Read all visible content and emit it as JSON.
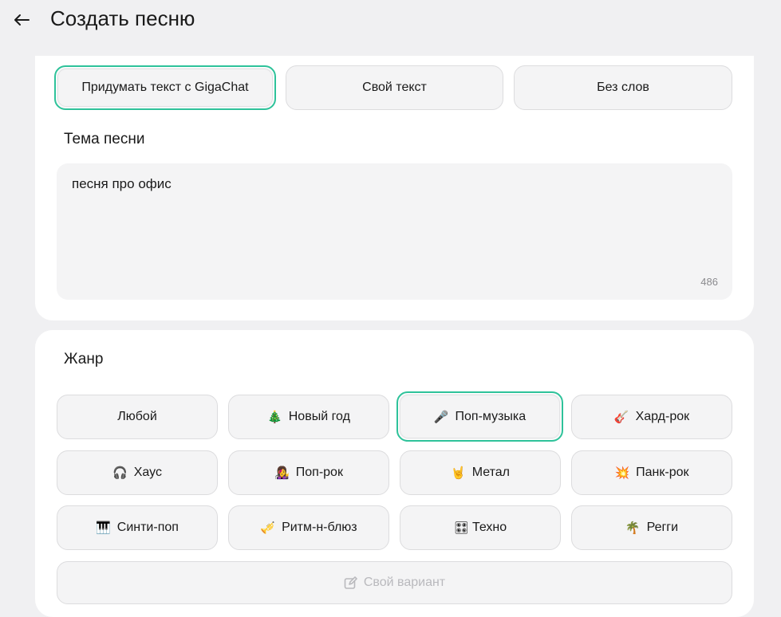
{
  "header": {
    "title": "Создать песню"
  },
  "modes": [
    {
      "label": "Придумать текст с GigaChat",
      "selected": true
    },
    {
      "label": "Свой текст",
      "selected": false
    },
    {
      "label": "Без слов",
      "selected": false
    }
  ],
  "theme": {
    "label": "Тема песни",
    "value": "песня про офис",
    "counter": "486"
  },
  "genre": {
    "label": "Жанр",
    "items": [
      {
        "emoji": "",
        "label": "Любой"
      },
      {
        "emoji": "🎄",
        "label": "Новый год"
      },
      {
        "emoji": "🎤",
        "label": "Поп-музыка",
        "selected": true
      },
      {
        "emoji": "🎸",
        "label": "Хард-рок"
      },
      {
        "emoji": "🎧",
        "label": "Хаус"
      },
      {
        "emoji": "👩‍🎤",
        "label": "Поп-рок"
      },
      {
        "emoji": "🤘",
        "label": "Метал"
      },
      {
        "emoji": "💥",
        "label": "Панк-рок"
      },
      {
        "emoji": "🎹",
        "label": "Синти-поп"
      },
      {
        "emoji": "🎺",
        "label": "Ритм-н-блюз"
      },
      {
        "emoji": "🎛",
        "label": "Техно"
      },
      {
        "emoji": "🌴",
        "label": "Регги"
      }
    ],
    "custom_label": "Свой вариант"
  },
  "colors": {
    "accent": "#2ec29a",
    "background": "#f0f0f2",
    "card": "#ffffff"
  }
}
